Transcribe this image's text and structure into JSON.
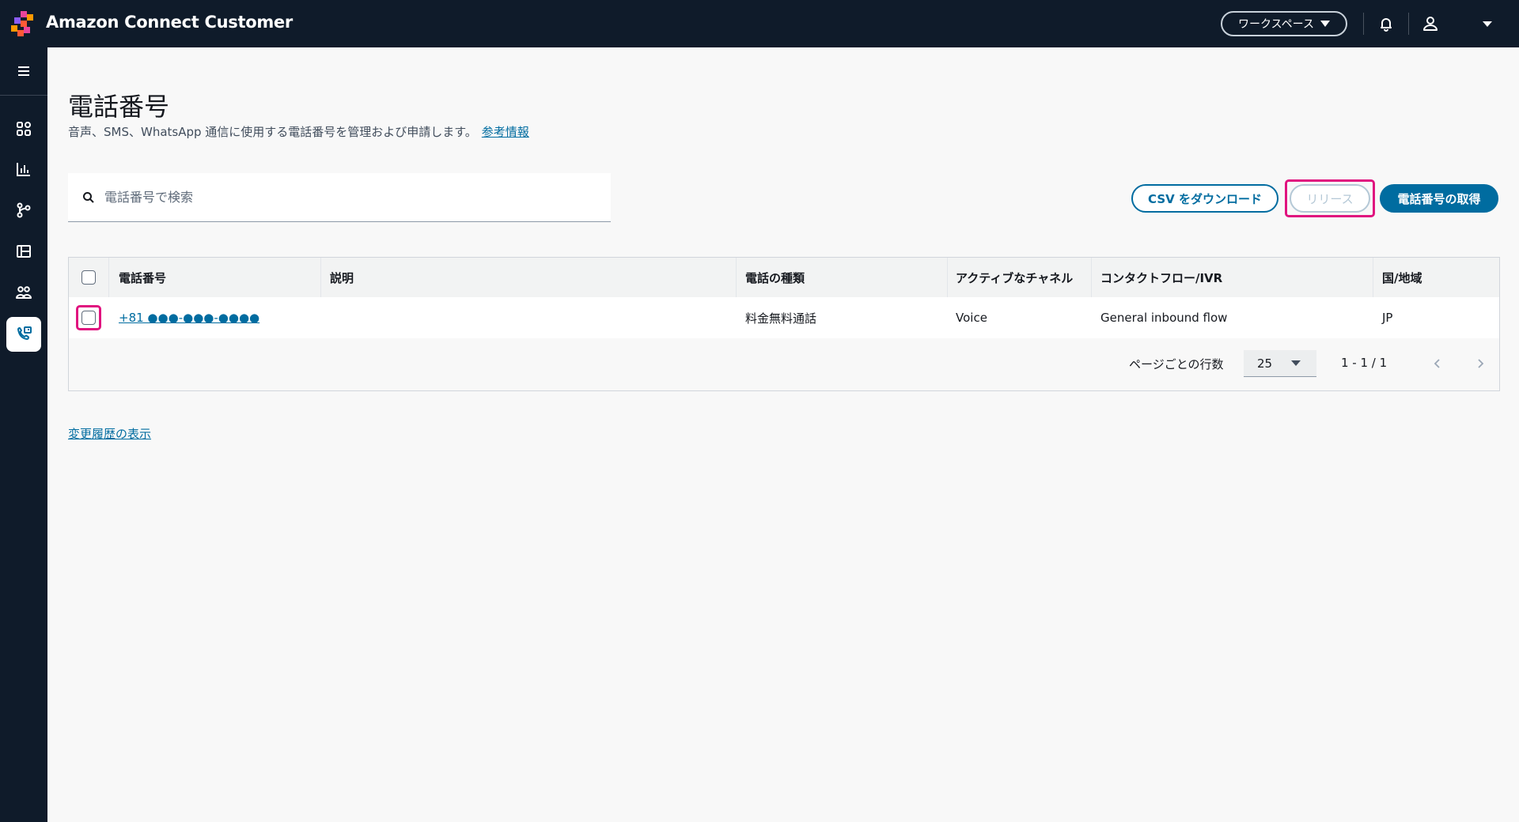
{
  "app": {
    "title": "Amazon Connect Customer"
  },
  "topbar": {
    "workspace_label": "ワークスペース"
  },
  "page": {
    "title": "電話番号",
    "description": "音声、SMS、WhatsApp 通信に使用する電話番号を管理および申請します。",
    "info_link": "参考情報"
  },
  "search": {
    "placeholder": "電話番号で検索",
    "value": ""
  },
  "actions": {
    "download_csv": "CSV をダウンロード",
    "release": "リリース",
    "claim_number": "電話番号の取得"
  },
  "table": {
    "columns": [
      "電話番号",
      "説明",
      "電話の種類",
      "アクティブなチャネル",
      "コンタクトフロー/IVR",
      "国/地域"
    ],
    "rows": [
      {
        "phone": "+81 ●●●-●●●-●●●●",
        "description": "",
        "type": "料金無料通話",
        "channel": "Voice",
        "flow": "General inbound flow",
        "country": "JP"
      }
    ]
  },
  "pagination": {
    "rows_per_page_label": "ページごとの行数",
    "rows_per_page": "25",
    "range": "1 - 1  / 1"
  },
  "footer": {
    "history_link": "変更履歴の表示"
  },
  "colors": {
    "topbar_bg": "#0f1b2a",
    "primary": "#006ca0",
    "highlight": "#e0137f"
  }
}
